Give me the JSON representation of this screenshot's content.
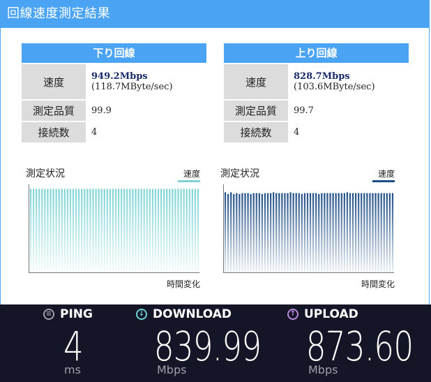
{
  "header": {
    "title": "回線速度測定結果"
  },
  "download_panel": {
    "title": "下り回線",
    "rows": [
      {
        "label": "速度",
        "value": "949.2Mbps",
        "sub": "(118.7MByte/sec)"
      },
      {
        "label": "測定品質",
        "value": "99.9"
      },
      {
        "label": "接続数",
        "value": "4"
      }
    ]
  },
  "upload_panel": {
    "title": "上り回線",
    "rows": [
      {
        "label": "速度",
        "value": "828.7Mbps",
        "sub": "(103.6MByte/sec)"
      },
      {
        "label": "測定品質",
        "value": "99.7"
      },
      {
        "label": "接続数",
        "value": "4"
      }
    ]
  },
  "chart_data": [
    {
      "type": "bar",
      "title": "測定状況",
      "xlabel": "時間変化",
      "legend": "速度",
      "color": "#7dd3d5",
      "values": [
        0.98,
        0.98,
        0.98,
        0.98,
        0.98,
        0.98,
        0.98,
        0.98,
        0.98,
        0.98,
        0.98,
        0.98,
        0.98,
        0.98,
        0.98,
        0.98,
        0.98,
        0.98,
        0.98,
        0.98,
        0.98,
        0.98,
        0.98,
        0.98,
        0.98,
        0.98,
        0.98,
        0.98,
        0.98,
        0.98,
        0.98,
        0.98,
        0.98,
        0.98,
        0.98,
        0.98,
        0.98,
        0.98,
        0.98,
        0.98,
        0.98,
        0.98,
        0.98,
        0.98,
        0.98,
        0.98,
        0.98,
        0.98,
        0.98,
        0.98,
        0.98,
        0.98,
        0.98,
        0.98,
        0.98,
        0.98,
        0.98,
        0.98,
        0.98,
        0.98
      ],
      "ylim": [
        0,
        1
      ]
    },
    {
      "type": "bar",
      "title": "測定状況",
      "xlabel": "時間変化",
      "legend": "速度",
      "color": "#1f4e86",
      "values": [
        0.94,
        0.92,
        0.94,
        0.92,
        0.93,
        0.92,
        0.93,
        0.93,
        0.93,
        0.92,
        0.93,
        0.93,
        0.93,
        0.92,
        0.93,
        0.93,
        0.93,
        0.94,
        0.93,
        0.93,
        0.93,
        0.93,
        0.93,
        0.94,
        0.93,
        0.93,
        0.93,
        0.92,
        0.93,
        0.93,
        0.93,
        0.93,
        0.93,
        0.92,
        0.93,
        0.93,
        0.93,
        0.93,
        0.93,
        0.93,
        0.93,
        0.93,
        0.93,
        0.94,
        0.93,
        0.93,
        0.93,
        0.93,
        0.93,
        0.93,
        0.93,
        0.93,
        0.93,
        0.93,
        0.93,
        0.93,
        0.93,
        0.93,
        0.93,
        0.93
      ],
      "ylim": [
        0,
        1
      ]
    }
  ],
  "results": {
    "ping": {
      "label": "PING",
      "value": "4",
      "unit": "ms",
      "color": "#9da0ad"
    },
    "download": {
      "label": "DOWNLOAD",
      "value": "839.99",
      "unit": "Mbps",
      "color": "#6fd3d6"
    },
    "upload": {
      "label": "UPLOAD",
      "value": "873.60",
      "unit": "Mbps",
      "color": "#b98ae0"
    }
  }
}
